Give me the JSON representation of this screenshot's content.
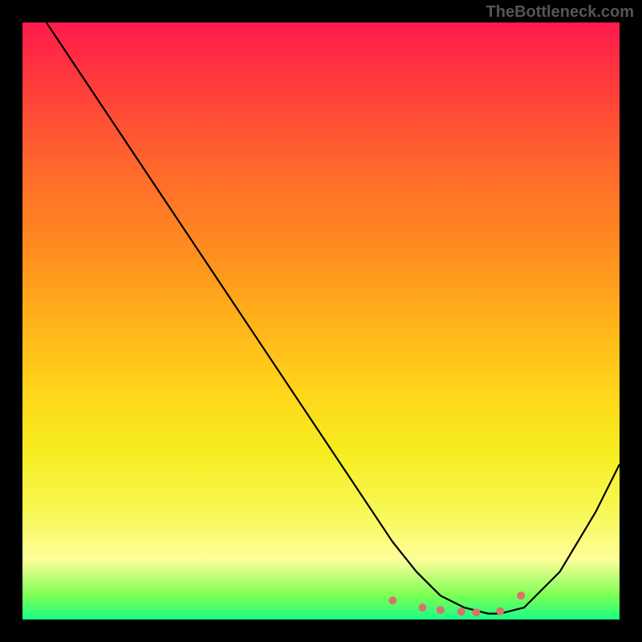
{
  "watermark": "TheBottleneck.com",
  "chart_data": {
    "type": "line",
    "title": "",
    "xlabel": "",
    "ylabel": "",
    "xlim": [
      0,
      100
    ],
    "ylim": [
      0,
      100
    ],
    "series": [
      {
        "name": "curve",
        "x": [
          4,
          10,
          20,
          30,
          40,
          50,
          58,
          62,
          66,
          70,
          74,
          78,
          80,
          84,
          90,
          96,
          100
        ],
        "y": [
          100,
          91,
          76,
          61,
          46,
          31,
          19,
          13,
          8,
          4,
          2,
          1,
          1,
          2,
          8,
          18,
          26
        ]
      }
    ],
    "markers": {
      "name": "dots",
      "color": "#d9726c",
      "radius": 5,
      "points": [
        {
          "x": 62,
          "y": 3.2
        },
        {
          "x": 67,
          "y": 2.0
        },
        {
          "x": 70,
          "y": 1.6
        },
        {
          "x": 73.5,
          "y": 1.3
        },
        {
          "x": 76,
          "y": 1.2
        },
        {
          "x": 80,
          "y": 1.4
        },
        {
          "x": 83.5,
          "y": 4.0
        }
      ]
    },
    "gradient_stops": [
      {
        "offset": 0,
        "color": "#ff1a4d"
      },
      {
        "offset": 10,
        "color": "#ff3b3b"
      },
      {
        "offset": 25,
        "color": "#ff6a2b"
      },
      {
        "offset": 38,
        "color": "#ff8c1f"
      },
      {
        "offset": 50,
        "color": "#ffb21a"
      },
      {
        "offset": 62,
        "color": "#ffd61a"
      },
      {
        "offset": 72,
        "color": "#f5ed1f"
      },
      {
        "offset": 82,
        "color": "#f8f856"
      },
      {
        "offset": 90,
        "color": "#fdfe9a"
      },
      {
        "offset": 96,
        "color": "#7bff54"
      },
      {
        "offset": 100,
        "color": "#18ff86"
      }
    ]
  }
}
